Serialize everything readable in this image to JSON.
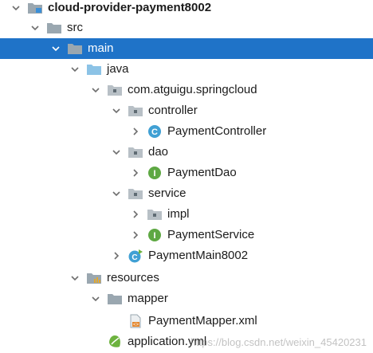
{
  "tree": [
    {
      "label": "cloud-provider-payment8002",
      "chev": "down",
      "icon": "module-folder",
      "bold": true
    },
    {
      "label": "src",
      "chev": "down",
      "icon": "folder"
    },
    {
      "label": "main",
      "chev": "down",
      "icon": "folder",
      "selected": true
    },
    {
      "label": "java",
      "chev": "down",
      "icon": "source-folder"
    },
    {
      "label": "com.atguigu.springcloud",
      "chev": "down",
      "icon": "package"
    },
    {
      "label": "controller",
      "chev": "down",
      "icon": "package"
    },
    {
      "label": "PaymentController",
      "chev": "right",
      "icon": "class"
    },
    {
      "label": "dao",
      "chev": "down",
      "icon": "package"
    },
    {
      "label": "PaymentDao",
      "chev": "right",
      "icon": "interface"
    },
    {
      "label": "service",
      "chev": "down",
      "icon": "package"
    },
    {
      "label": "impl",
      "chev": "right",
      "icon": "package"
    },
    {
      "label": "PaymentService",
      "chev": "right",
      "icon": "interface"
    },
    {
      "label": "PaymentMain8002",
      "chev": "right",
      "icon": "spring-boot-class"
    },
    {
      "label": "resources",
      "chev": "down",
      "icon": "resources-folder"
    },
    {
      "label": "mapper",
      "chev": "down",
      "icon": "folder"
    },
    {
      "label": "PaymentMapper.xml",
      "chev": "none",
      "icon": "xml-file"
    },
    {
      "label": "application.yml",
      "chev": "none",
      "icon": "yaml-spring-file"
    }
  ],
  "watermark": "https://blog.csdn.net/weixin_45420231",
  "colors": {
    "selection": "#1f73c8",
    "folder": "#9aa7b0",
    "source_folder": "#8cc3e6",
    "class": "#40a0d4",
    "interface": "#5ea843",
    "spring": "#6db33f"
  }
}
